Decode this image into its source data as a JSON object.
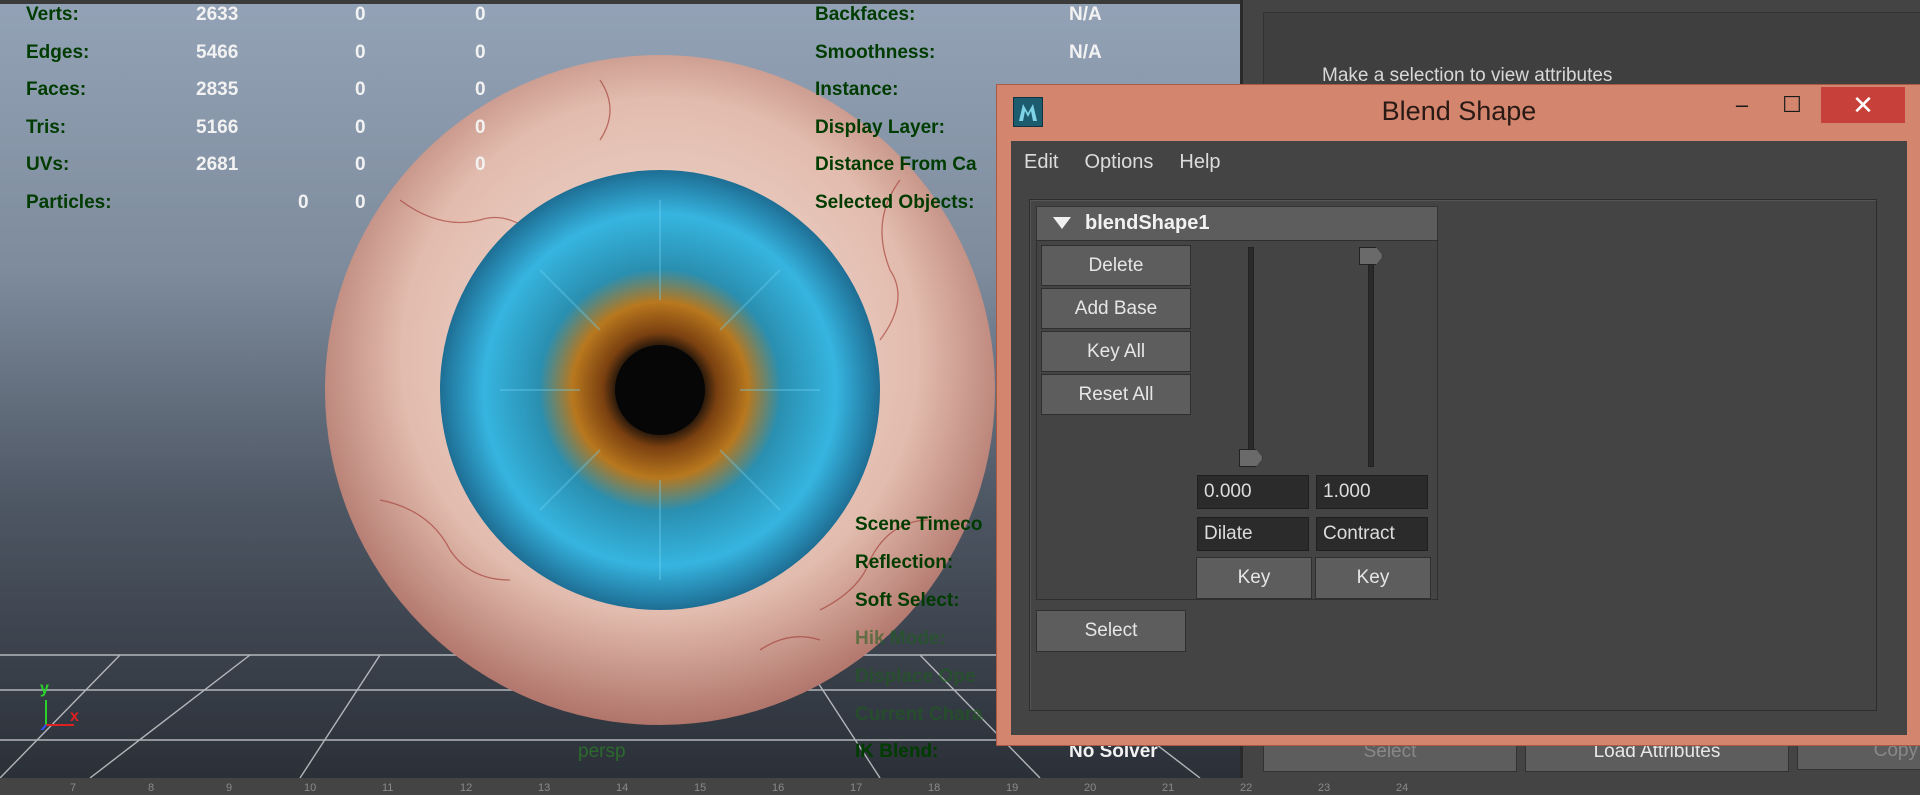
{
  "viewport": {
    "camera_label": "persp",
    "axis": {
      "y": "y",
      "x": "x"
    },
    "stats": [
      {
        "label": "Verts:",
        "v1": "2633",
        "v2": "0",
        "v3": "0"
      },
      {
        "label": "Edges:",
        "v1": "5466",
        "v2": "0",
        "v3": "0"
      },
      {
        "label": "Faces:",
        "v1": "2835",
        "v2": "0",
        "v3": "0"
      },
      {
        "label": "Tris:",
        "v1": "5166",
        "v2": "0",
        "v3": "0"
      },
      {
        "label": "UVs:",
        "v1": "2681",
        "v2": "0",
        "v3": "0"
      },
      {
        "label": "Particles:",
        "v1": "",
        "v2": "0",
        "v3": "0"
      }
    ],
    "right_hud": [
      {
        "label": "Backfaces:",
        "value": "N/A"
      },
      {
        "label": "Smoothness:",
        "value": "N/A"
      },
      {
        "label": "Instance:",
        "value": ""
      },
      {
        "label": "Display Layer:",
        "value": ""
      },
      {
        "label": "Distance From Ca",
        "value": ""
      },
      {
        "label": "Selected Objects:",
        "value": ""
      }
    ],
    "lower_hud": [
      {
        "label": "Scene Timeco"
      },
      {
        "label": "Reflection:"
      },
      {
        "label": "Soft Select:"
      },
      {
        "label": "Hik Mode:"
      },
      {
        "label": "Displace Ope"
      },
      {
        "label": "Current Chara"
      }
    ],
    "ik_blend": {
      "label": "IK Blend:",
      "value": "No Solver"
    }
  },
  "timeline": {
    "ticks": [
      "7",
      "8",
      "9",
      "10",
      "11",
      "12",
      "13",
      "14",
      "15",
      "16",
      "17",
      "18",
      "19",
      "20",
      "21",
      "22",
      "23",
      "24"
    ]
  },
  "attribute_editor": {
    "message": "Make a selection to view attributes",
    "select_label": "Select",
    "load_label": "Load Attributes",
    "copy_label": "Copy"
  },
  "dialog": {
    "title": "Blend Shape",
    "controls": {
      "minimize": "–",
      "maximize": "☐",
      "close": "✕"
    },
    "menu": [
      "Edit",
      "Options",
      "Help"
    ],
    "node_name": "blendShape1",
    "buttons": {
      "delete": "Delete",
      "add_base": "Add Base",
      "key_all": "Key All",
      "reset_all": "Reset All",
      "select": "Select"
    },
    "targets": [
      {
        "value": "0.000",
        "name": "Dilate",
        "key": "Key",
        "weight": 0.0
      },
      {
        "value": "1.000",
        "name": "Contract",
        "key": "Key",
        "weight": 1.0
      }
    ]
  }
}
